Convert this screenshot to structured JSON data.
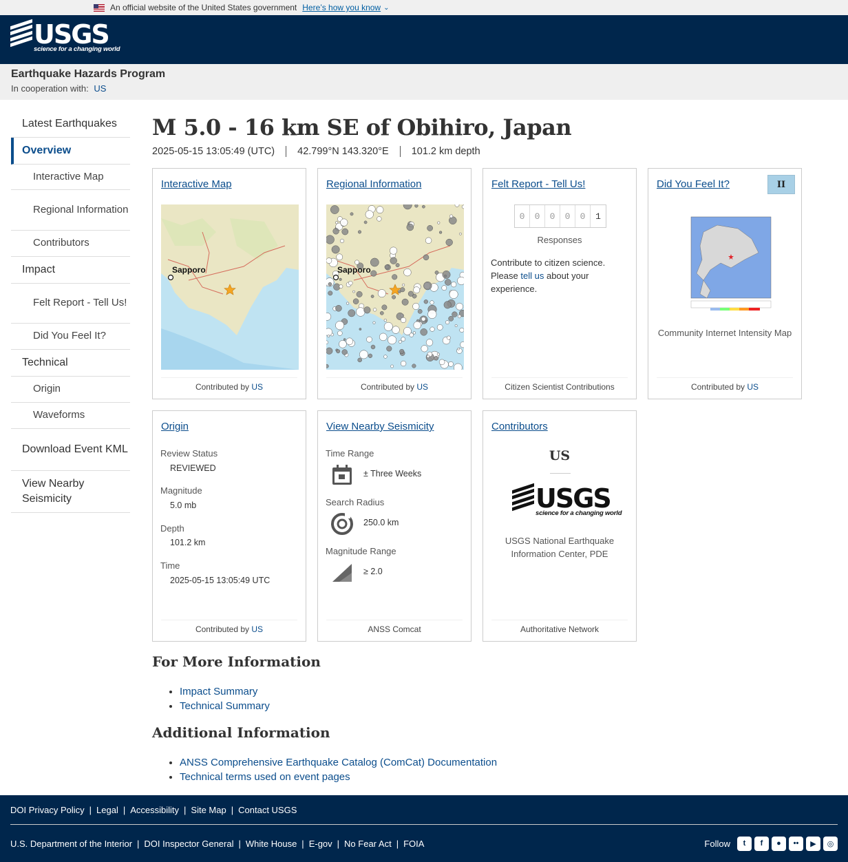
{
  "gov_banner": {
    "text": "An official website of the United States government",
    "link": "Here’s how you know"
  },
  "logo": {
    "word": "USGS",
    "tagline": "science for a changing world"
  },
  "program": {
    "title": "Earthquake Hazards Program",
    "coop_label": "In cooperation with:",
    "coop_link": "US"
  },
  "sidebar": {
    "items": [
      {
        "label": "Latest Earthquakes"
      },
      {
        "label": "Overview"
      },
      {
        "label": "Interactive Map"
      },
      {
        "label": "Regional Information"
      },
      {
        "label": "Contributors"
      },
      {
        "label": "Impact"
      },
      {
        "label": "Felt Report - Tell Us!"
      },
      {
        "label": "Did You Feel It?"
      },
      {
        "label": "Technical"
      },
      {
        "label": "Origin"
      },
      {
        "label": "Waveforms"
      },
      {
        "label": "Download Event KML"
      },
      {
        "label": "View Nearby Seismicity"
      }
    ]
  },
  "event": {
    "title": "M 5.0 - 16 km SE of Obihiro, Japan",
    "time": "2025-05-15 13:05:49 (UTC)",
    "location": "42.799°N 143.320°E",
    "depth": "101.2 km depth"
  },
  "cards": {
    "interactive_map": {
      "title": "Interactive Map",
      "city": "Sapporo",
      "foot_prefix": "Contributed by",
      "foot_link": "US"
    },
    "regional": {
      "title": "Regional Information",
      "city": "Sapporo",
      "foot_prefix": "Contributed by",
      "foot_link": "US"
    },
    "felt": {
      "title": "Felt Report - Tell Us!",
      "digits": [
        "0",
        "0",
        "0",
        "0",
        "0",
        "1"
      ],
      "responses": "Responses",
      "text_before": "Contribute to citizen science. Please",
      "text_link": "tell us",
      "text_after": "about your experience.",
      "foot": "Citizen Scientist Contributions"
    },
    "dyfi": {
      "title": "Did You Feel It?",
      "mmi": "II",
      "caption": "Community Internet Intensity Map",
      "foot_prefix": "Contributed by",
      "foot_link": "US"
    },
    "origin": {
      "title": "Origin",
      "review_label": "Review Status",
      "review_value": "REVIEWED",
      "magnitude_label": "Magnitude",
      "magnitude_value": "5.0 mb",
      "depth_label": "Depth",
      "depth_value": "101.2 km",
      "time_label": "Time",
      "time_value": "2025-05-15 13:05:49 UTC",
      "foot_prefix": "Contributed by",
      "foot_link": "US"
    },
    "nearby": {
      "title": "View Nearby Seismicity",
      "time_label": "Time Range",
      "time_value": "± Three Weeks",
      "radius_label": "Search Radius",
      "radius_value": "250.0 km",
      "mag_label": "Magnitude Range",
      "mag_value": "≥ 2.0",
      "foot": "ANSS Comcat"
    },
    "contributors": {
      "title": "Contributors",
      "code": "US",
      "name": "USGS National Earthquake Information Center, PDE",
      "foot": "Authoritative Network"
    }
  },
  "more_info": {
    "heading": "For More Information",
    "links": [
      "Impact Summary",
      "Technical Summary"
    ]
  },
  "additional_info": {
    "heading": "Additional Information",
    "links": [
      "ANSS Comprehensive Earthquake Catalog (ComCat) Documentation",
      "Technical terms used on event pages"
    ]
  },
  "footer": {
    "row1": [
      "DOI Privacy Policy",
      "Legal",
      "Accessibility",
      "Site Map",
      "Contact USGS"
    ],
    "row2": [
      "U.S. Department of the Interior",
      "DOI Inspector General",
      "White House",
      "E-gov",
      "No Fear Act",
      "FOIA"
    ],
    "follow": "Follow",
    "social_icons": [
      "twitter-icon",
      "facebook-icon",
      "github-icon",
      "flickr-icon",
      "youtube-icon",
      "instagram-icon"
    ]
  },
  "colors": {
    "header": "#00264c",
    "link": "#0b4d8c",
    "mmi_badge": "#a8d0e6",
    "epicenter": "#f5a623"
  }
}
